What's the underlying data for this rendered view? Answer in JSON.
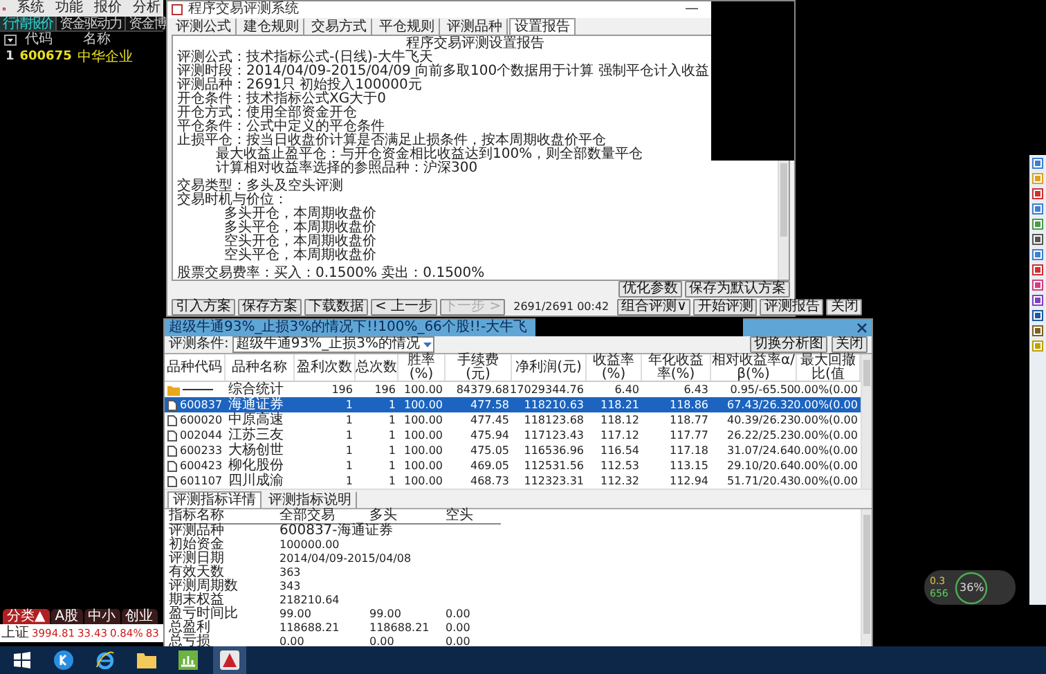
{
  "menu": [
    "系统",
    "功能",
    "报价",
    "分析"
  ],
  "quote_panel": {
    "tabs": [
      {
        "label": "行情报价",
        "selected": true
      },
      {
        "label": "资金驱动力",
        "selected": false
      },
      {
        "label": "资金博",
        "selected": false
      }
    ],
    "columns": [
      "代码",
      "名称"
    ],
    "rows": [
      {
        "index": "1",
        "code": "600675",
        "name": "中华企业"
      }
    ],
    "bottom_tabs": [
      {
        "label": "分类▲",
        "selected": true
      },
      {
        "label": "A股",
        "selected": false
      },
      {
        "label": "中小",
        "selected": false
      },
      {
        "label": "创业",
        "selected": false
      }
    ],
    "index_bar": {
      "name": "上证",
      "value": "3994.81",
      "change": "33.43",
      "percent": "0.84%",
      "volume": "83"
    }
  },
  "setup_window": {
    "title": "程序交易评测系统",
    "minimize": "—",
    "tabs": [
      {
        "label": "评测公式",
        "selected": false
      },
      {
        "label": "建仓规则",
        "selected": false
      },
      {
        "label": "交易方式",
        "selected": false
      },
      {
        "label": "平仓规则",
        "selected": false
      },
      {
        "label": "评测品种",
        "selected": false
      },
      {
        "label": "设置报告",
        "selected": true
      }
    ],
    "report": [
      {
        "kind": "title",
        "text": "程序交易评测设置报告"
      },
      {
        "kind": "line",
        "text": "评测公式：技术指标公式-(日线)-大牛飞天"
      },
      {
        "kind": "line",
        "text": "评测时段：2014/04/09-2015/04/09 向前多取100个数据用于计算 强制平仓计入收益"
      },
      {
        "kind": "line",
        "text": "评测品种：2691只 初始投入100000元"
      },
      {
        "kind": "line",
        "text": "开仓条件：技术指标公式XG大于0"
      },
      {
        "kind": "line",
        "text": "开仓方式：使用全部资金开仓"
      },
      {
        "kind": "line",
        "text": "平仓条件：公式中定义的平仓条件"
      },
      {
        "kind": "line",
        "text": "止损平仓：按当日收盘价计算是否满足止损条件，按本周期收盘价平仓"
      },
      {
        "kind": "sub",
        "text": "最大收益止盈平仓：与开仓资金相比收益达到100%，则全部数量平仓"
      },
      {
        "kind": "sub",
        "text": "计算相对收益率选择的参照品种：沪深300"
      },
      {
        "kind": "gap"
      },
      {
        "kind": "line",
        "text": "交易类型：多头及空头评测"
      },
      {
        "kind": "line",
        "text": "交易时机与价位："
      },
      {
        "kind": "item",
        "text": "多头开仓，本周期收盘价"
      },
      {
        "kind": "item",
        "text": "多头平仓，本周期收盘价"
      },
      {
        "kind": "item",
        "text": "空头开仓，本周期收盘价"
      },
      {
        "kind": "item",
        "text": "空头平仓，本周期收盘价"
      },
      {
        "kind": "gap"
      },
      {
        "kind": "line",
        "text": "股票交易费率：买入：0.1500%  卖出：0.1500%"
      }
    ],
    "side_buttons": [
      "优化参数",
      "保存为默认方案"
    ],
    "buttons": [
      {
        "label": "引入方案",
        "disabled": false
      },
      {
        "label": "保存方案",
        "disabled": false
      },
      {
        "label": "下载数据",
        "disabled": false
      },
      {
        "label": "< 上一步",
        "disabled": false
      },
      {
        "label": "下一步 >",
        "disabled": true
      }
    ],
    "progress": "2691/2691 00:42",
    "right_buttons": [
      {
        "label": "组合评测∨",
        "disabled": false
      },
      {
        "label": "开始评测",
        "disabled": false
      },
      {
        "label": "评测报告",
        "disabled": false
      },
      {
        "label": "关闭",
        "disabled": false
      }
    ]
  },
  "result_window": {
    "title": "超级牛通93%_止损3%的情况下!!100%_66个股!!-大牛飞",
    "condition_label": "评测条件:",
    "condition_value": "超级牛通93%_止损3%的情况",
    "buttons": [
      "切换分析图",
      "关闭"
    ],
    "columns": [
      "品种代码",
      "品种名称",
      "盈利次数",
      "总次数",
      "胜率(%)",
      "手续费(元)",
      "净利润(元)",
      "收益率(%)",
      "年化收益率(%)",
      "相对收益率α/β(%)",
      "最大回撤比(值"
    ],
    "rows": [
      {
        "kind": "summary",
        "selected": false,
        "cells": [
          "",
          "综合统计",
          "196",
          "196",
          "100.00",
          "84379.68",
          "17029344.76",
          "6.40",
          "6.43",
          "0.95/-65.50",
          "0.00%(0.00"
        ]
      },
      {
        "kind": "stock",
        "selected": true,
        "cells": [
          "600837",
          "海通证券",
          "1",
          "1",
          "100.00",
          "477.58",
          "118210.63",
          "118.21",
          "118.86",
          "67.43/26.32",
          "0.00%(0.00"
        ]
      },
      {
        "kind": "stock",
        "selected": false,
        "cells": [
          "600020",
          "中原高速",
          "1",
          "1",
          "100.00",
          "477.45",
          "118123.68",
          "118.12",
          "118.77",
          "40.39/26.23",
          "0.00%(0.00"
        ]
      },
      {
        "kind": "stock",
        "selected": false,
        "cells": [
          "002044",
          "江苏三友",
          "1",
          "1",
          "100.00",
          "475.94",
          "117123.43",
          "117.12",
          "117.77",
          "26.22/25.23",
          "0.00%(0.00"
        ]
      },
      {
        "kind": "stock",
        "selected": false,
        "cells": [
          "600233",
          "大杨创世",
          "1",
          "1",
          "100.00",
          "475.05",
          "116536.96",
          "116.54",
          "117.18",
          "31.07/24.64",
          "0.00%(0.00"
        ]
      },
      {
        "kind": "stock",
        "selected": false,
        "cells": [
          "600423",
          "柳化股份",
          "1",
          "1",
          "100.00",
          "469.05",
          "112531.56",
          "112.53",
          "113.15",
          "29.10/20.64",
          "0.00%(0.00"
        ]
      },
      {
        "kind": "stock",
        "selected": false,
        "cells": [
          "601107",
          "四川成渝",
          "1",
          "1",
          "100.00",
          "468.73",
          "112323.31",
          "112.32",
          "112.94",
          "51.71/20.43",
          "0.00%(0.00"
        ]
      }
    ],
    "detail_tabs": [
      {
        "label": "评测指标详情",
        "selected": true
      },
      {
        "label": "评测指标说明",
        "selected": false
      }
    ],
    "detail_columns": [
      "指标名称",
      "全部交易",
      "多头",
      "空头"
    ],
    "detail_rows": [
      [
        "评测品种",
        "600837-海通证券"
      ],
      [
        "初始资金",
        "100000.00"
      ],
      [
        "评测日期",
        "2014/04/09-2015/04/08"
      ],
      [
        "有效天数",
        "363"
      ],
      [
        "评测周期数",
        "343"
      ],
      [
        "期末权益",
        "218210.64"
      ],
      [
        "盈亏时间比",
        "99.00",
        "99.00",
        "0.00"
      ],
      [
        "总盈利",
        "118688.21",
        "118688.21",
        "0.00"
      ],
      [
        "总亏损",
        "0.00",
        "0.00",
        "0.00"
      ]
    ]
  },
  "net_widget": {
    "upload": "0.3",
    "download": "656",
    "usage": "36%"
  },
  "taskbar": [
    {
      "kind": "start",
      "selected": false
    },
    {
      "kind": "k",
      "selected": false
    },
    {
      "kind": "ie",
      "selected": false
    },
    {
      "kind": "folder",
      "selected": false
    },
    {
      "kind": "chart",
      "selected": false
    },
    {
      "kind": "app",
      "selected": true
    }
  ]
}
